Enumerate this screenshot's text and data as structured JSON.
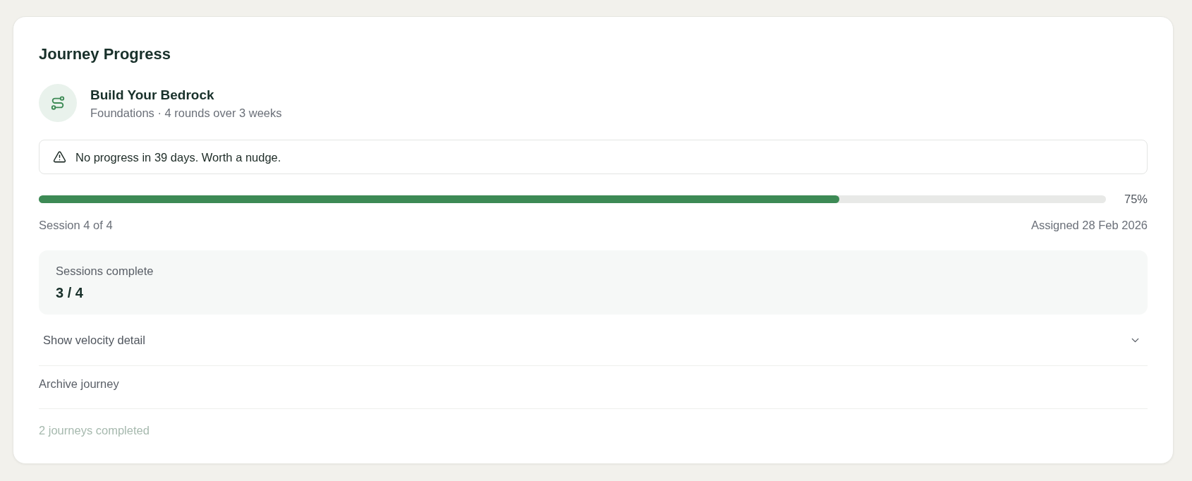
{
  "card": {
    "title": "Journey Progress"
  },
  "journey": {
    "name": "Build Your Bedrock",
    "subtitle": "Foundations · 4 rounds over 3 weeks"
  },
  "alert": {
    "text": "No progress in 39 days. Worth a nudge."
  },
  "progress": {
    "level": 0.75,
    "percent": "75%",
    "session": "Session 4 of 4",
    "assigned": "Assigned 28 Feb 2026"
  },
  "stats": {
    "label": "Sessions complete",
    "value": "3 / 4"
  },
  "velocity_toggle": {
    "label": "Show velocity detail",
    "expanded": false
  },
  "archive": {
    "label": "Archive journey"
  },
  "footer": {
    "text": "2 journeys completed"
  }
}
